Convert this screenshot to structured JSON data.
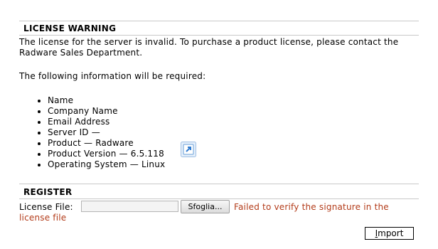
{
  "license_warning": {
    "title": "LICENSE WARNING",
    "message": "The license for the server is invalid. To purchase a product license, please contact the Radware Sales Department.",
    "info_intro": "The following information will be required:",
    "items": [
      "Name",
      "Company Name",
      "Email Address",
      "Server ID —",
      "Product — Radware",
      "Product Version — 6.5.118",
      "Operating System — Linux"
    ]
  },
  "register": {
    "title": "REGISTER",
    "license_file_label": "License File:",
    "file_value": "",
    "browse_label": "Sfoglia...",
    "error": "Failed to verify the signature in the license file",
    "import_label_first": "I",
    "import_label_rest": "mport"
  },
  "colors": {
    "error": "#b33c1a",
    "divider": "#c8c8c8",
    "icon_blue": "#4a90d9"
  },
  "icons": {
    "external_link": "external-link-icon"
  }
}
